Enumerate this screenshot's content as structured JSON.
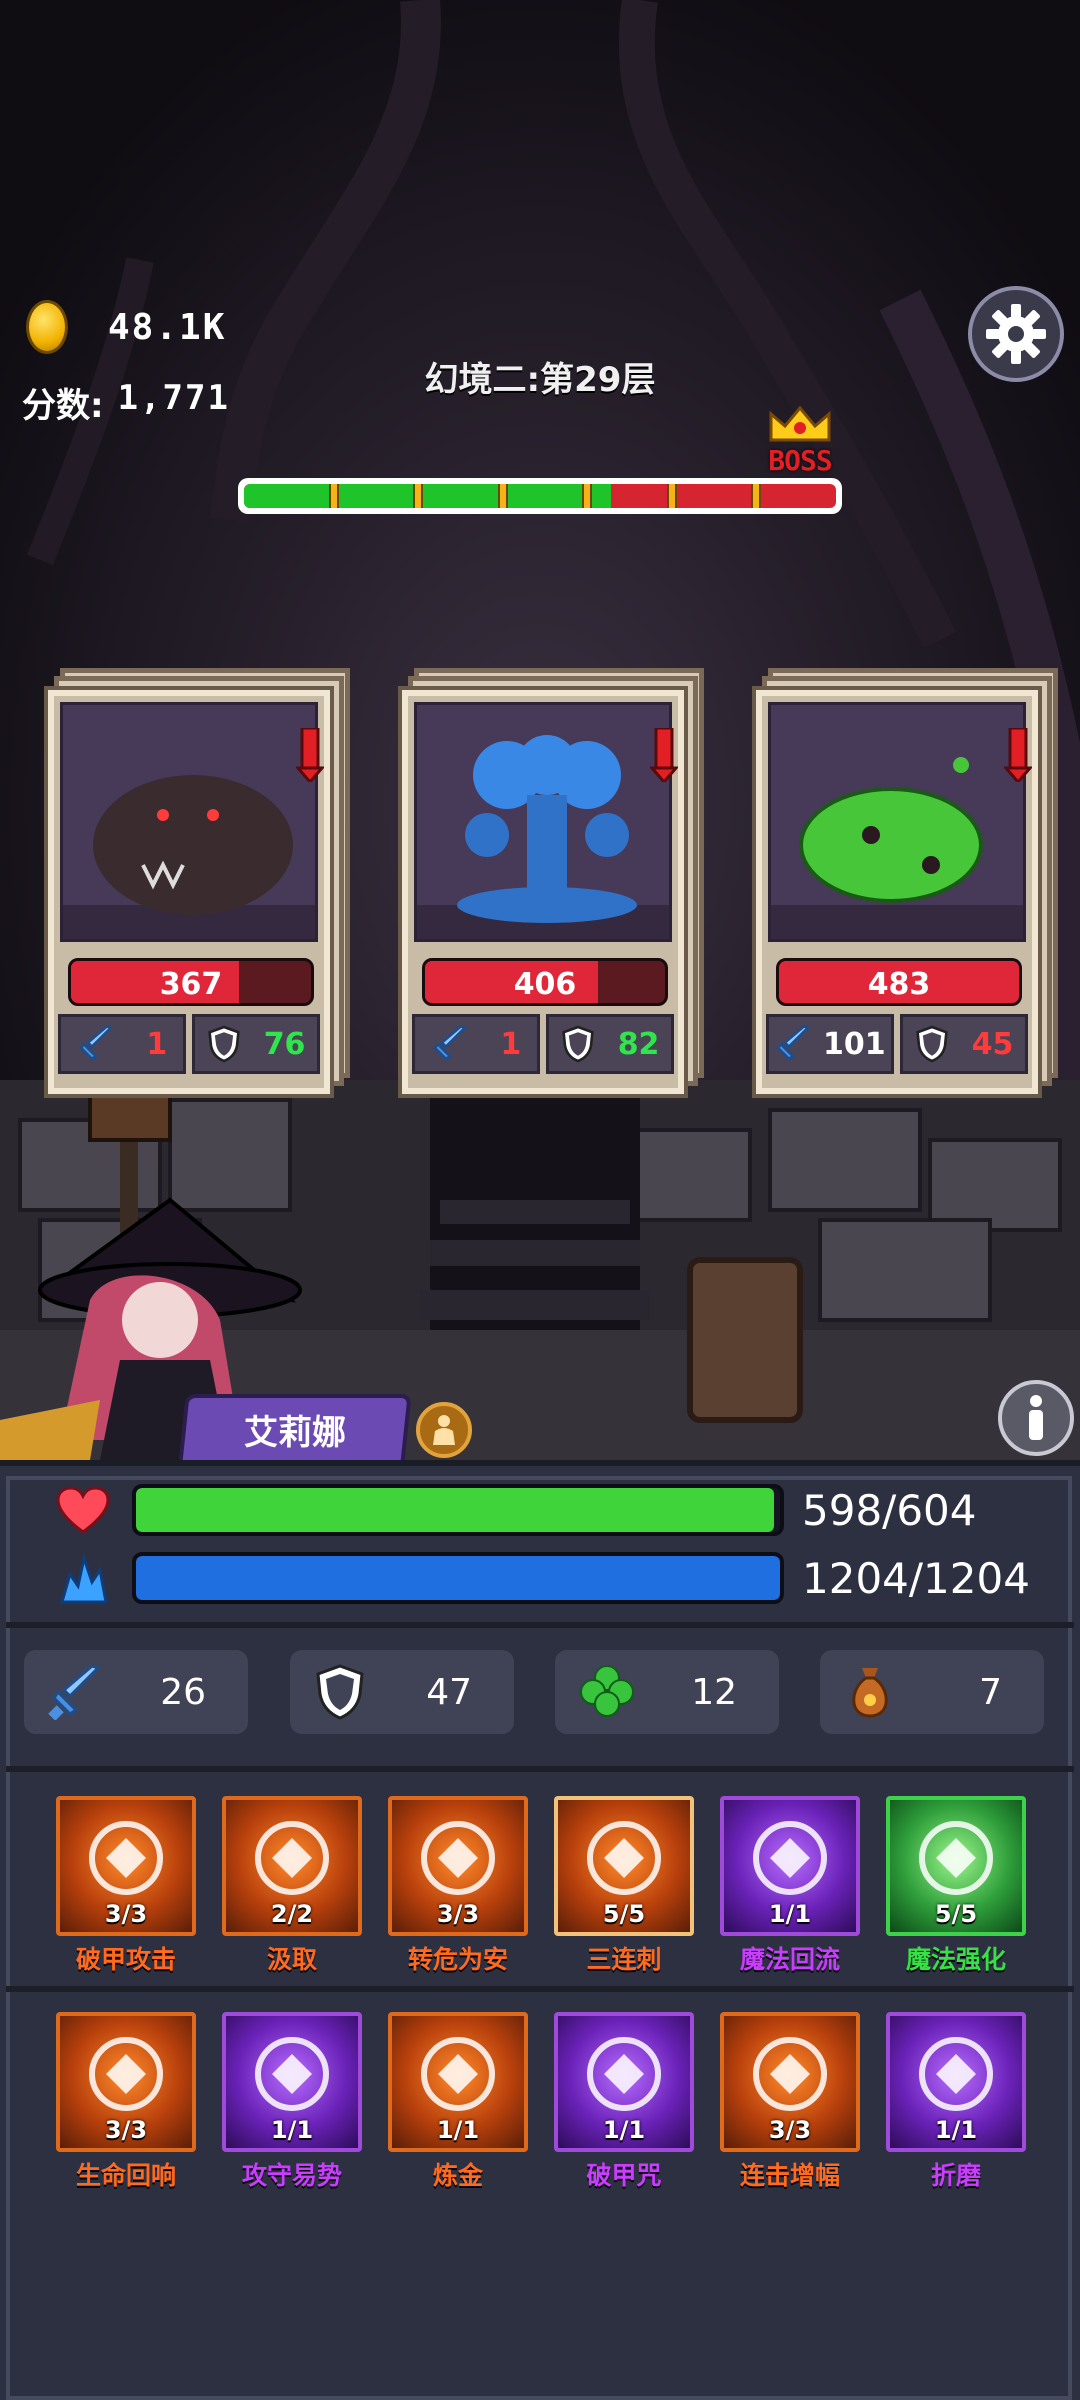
{
  "hud": {
    "gold": "48.1K",
    "score_label": "分数:",
    "score_value": "1,771",
    "stage_title": "幻境二:第29层",
    "boss_label": "BOSS",
    "progress_fraction": 0.62,
    "progress_ticks": 6
  },
  "enemies": [
    {
      "name_icon": "werewolf-beast",
      "hp": "367",
      "hp_fraction": 0.7,
      "attack": "1",
      "defense": "76",
      "defense_color": "#2ee64b",
      "attack_color": "#ff3b3b"
    },
    {
      "name_icon": "blue-tentacle-slime",
      "hp": "406",
      "hp_fraction": 0.72,
      "attack": "1",
      "defense": "82",
      "defense_color": "#2ee64b",
      "attack_color": "#ff3b3b"
    },
    {
      "name_icon": "green-slime",
      "hp": "483",
      "hp_fraction": 1.0,
      "attack": "101",
      "defense": "45",
      "defense_color": "#ff3b3b",
      "attack_color": "#ffffff"
    }
  ],
  "hero": {
    "name": "艾莉娜",
    "class_icon": "person-icon",
    "hp": "598/604",
    "hp_fraction": 0.99,
    "mp": "1204/1204",
    "mp_fraction": 1.0,
    "hp_color": "#3fd53a",
    "mp_color": "#1f6fe0"
  },
  "stats": [
    {
      "icon": "sword-icon",
      "value": "26"
    },
    {
      "icon": "shield-icon",
      "value": "47"
    },
    {
      "icon": "clover-icon",
      "value": "12"
    },
    {
      "icon": "money-bag-icon",
      "value": "7"
    }
  ],
  "skills_row1": [
    {
      "name": "破甲攻击",
      "level": "3/3",
      "tier": "orange",
      "color": "#ff6a1f"
    },
    {
      "name": "汲取",
      "level": "2/2",
      "tier": "orange",
      "color": "#ff6a1f"
    },
    {
      "name": "转危为安",
      "level": "3/3",
      "tier": "orange",
      "color": "#ff6a1f"
    },
    {
      "name": "三连刺",
      "level": "5/5",
      "tier": "orange-gold",
      "color": "#ff6a1f"
    },
    {
      "name": "魔法回流",
      "level": "1/1",
      "tier": "purple",
      "color": "#c93dff"
    },
    {
      "name": "魔法强化",
      "level": "5/5",
      "tier": "green",
      "color": "#36e046"
    }
  ],
  "skills_row2": [
    {
      "name": "生命回响",
      "level": "3/3",
      "tier": "orange",
      "color": "#ff6a1f"
    },
    {
      "name": "攻守易势",
      "level": "1/1",
      "tier": "purple",
      "color": "#c93dff"
    },
    {
      "name": "炼金",
      "level": "1/1",
      "tier": "orange",
      "color": "#ff6a1f"
    },
    {
      "name": "破甲咒",
      "level": "1/1",
      "tier": "purple",
      "color": "#c93dff"
    },
    {
      "name": "连击增幅",
      "level": "3/3",
      "tier": "orange",
      "color": "#ff6a1f"
    },
    {
      "name": "折磨",
      "level": "1/1",
      "tier": "purple",
      "color": "#c93dff"
    }
  ]
}
